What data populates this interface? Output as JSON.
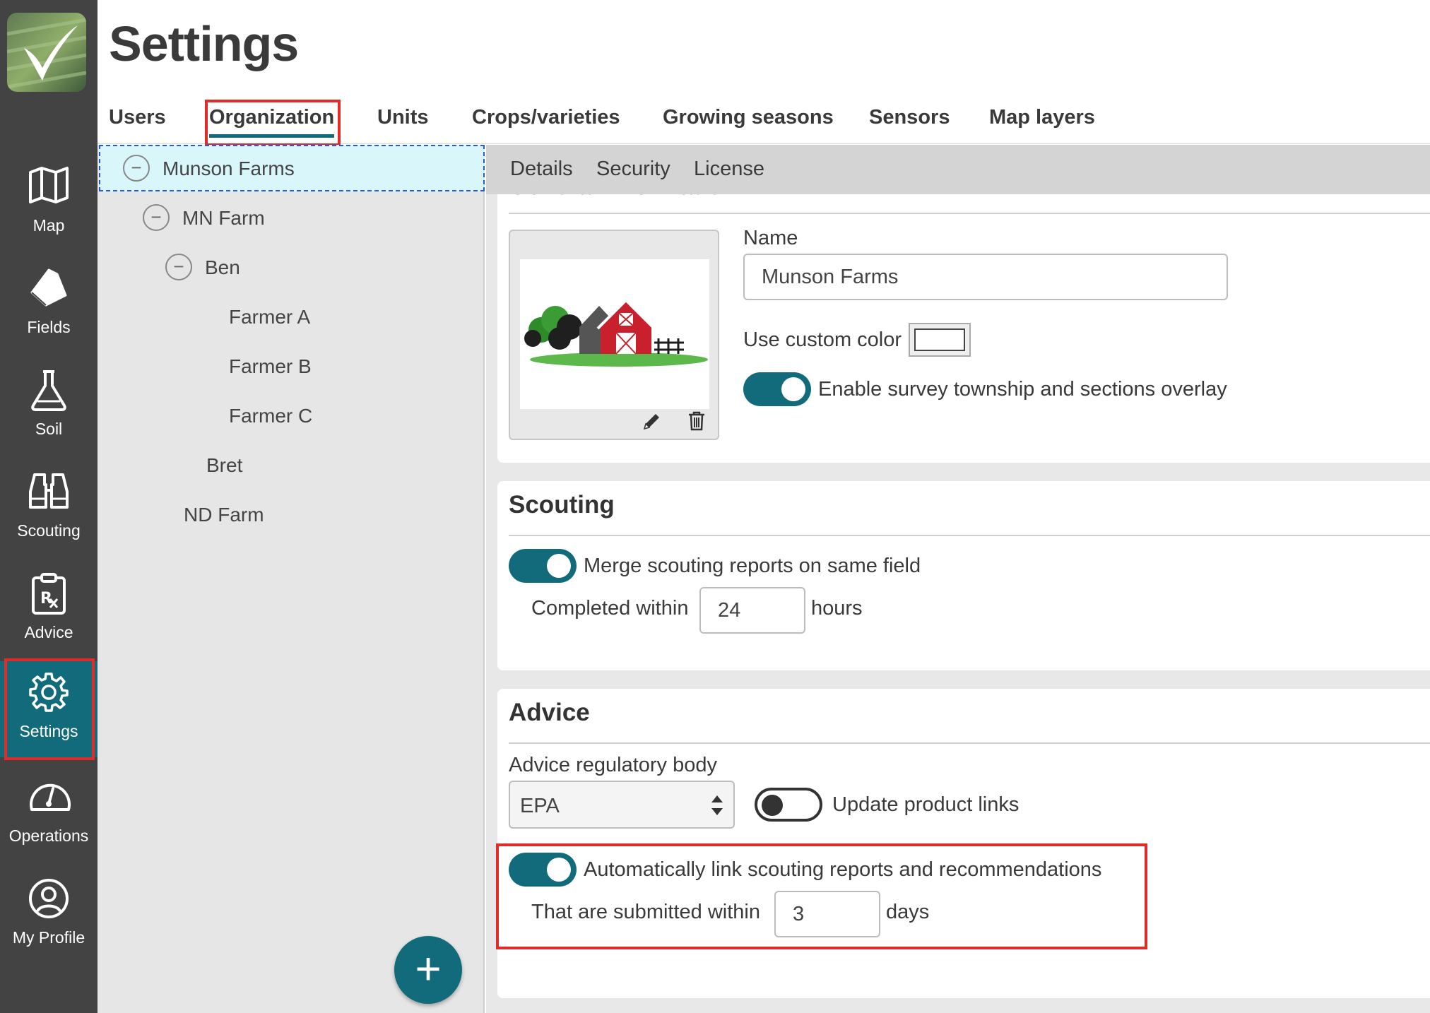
{
  "nav": {
    "items": [
      {
        "label": "Map",
        "icon": "map-icon"
      },
      {
        "label": "Fields",
        "icon": "fields-icon"
      },
      {
        "label": "Soil",
        "icon": "flask-icon"
      },
      {
        "label": "Scouting",
        "icon": "binoculars-icon"
      },
      {
        "label": "Advice",
        "icon": "prescription-icon"
      },
      {
        "label": "Settings",
        "icon": "gear-icon",
        "active": true
      },
      {
        "label": "Operations",
        "icon": "gauge-icon"
      },
      {
        "label": "My Profile",
        "icon": "user-icon"
      }
    ]
  },
  "header": {
    "title": "Settings"
  },
  "tabs": [
    {
      "label": "Users"
    },
    {
      "label": "Organization",
      "active": true
    },
    {
      "label": "Units"
    },
    {
      "label": "Crops/varieties"
    },
    {
      "label": "Growing seasons"
    },
    {
      "label": "Sensors"
    },
    {
      "label": "Map layers"
    }
  ],
  "tree": {
    "items": [
      {
        "label": "Munson Farms",
        "level": 0,
        "collapsible": true,
        "selected": true
      },
      {
        "label": "MN Farm",
        "level": 1,
        "collapsible": true
      },
      {
        "label": "Ben",
        "level": 2,
        "collapsible": true
      },
      {
        "label": "Farmer A",
        "level": 3
      },
      {
        "label": "Farmer B",
        "level": 3
      },
      {
        "label": "Farmer C",
        "level": 3
      },
      {
        "label": "Bret",
        "level": 2
      },
      {
        "label": "ND Farm",
        "level": 1
      }
    ],
    "collapse_glyph": "−",
    "add_glyph": "+"
  },
  "subtabs": [
    {
      "label": "Details",
      "active": true
    },
    {
      "label": "Security"
    },
    {
      "label": "License"
    }
  ],
  "general": {
    "title_partial": "General information",
    "name_label": "Name",
    "name_value": "Munson Farms",
    "custom_color_label": "Use custom color",
    "survey_label": "Enable survey township and sections overlay",
    "survey_on": true
  },
  "scouting": {
    "title": "Scouting",
    "merge_label": "Merge scouting reports on same field",
    "merge_on": true,
    "completed_label": "Completed within",
    "completed_value": "24",
    "completed_unit": "hours"
  },
  "advice": {
    "title": "Advice",
    "regulatory_label": "Advice regulatory body",
    "regulatory_value": "EPA",
    "product_links_label": "Update product links",
    "product_links_on": false,
    "autolink_label": "Automatically link scouting reports and recommendations",
    "autolink_on": true,
    "submitted_label": "That are submitted within",
    "submitted_value": "3",
    "submitted_unit": "days"
  },
  "colors": {
    "accent": "#126b7a",
    "nav_bg": "#434343",
    "highlight": "#e02b2b",
    "tree_selected_bg": "#d9f6fa"
  }
}
